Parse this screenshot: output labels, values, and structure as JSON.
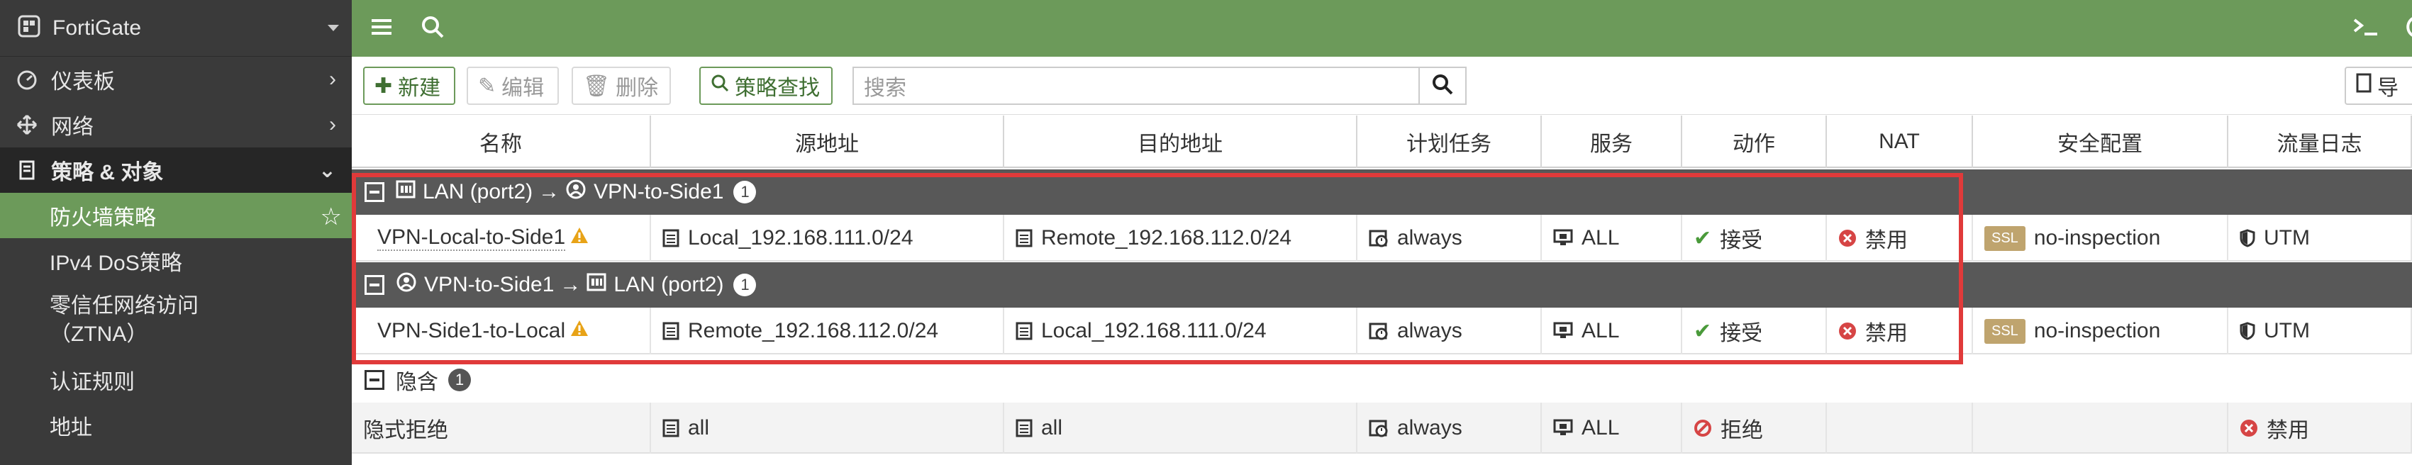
{
  "sidebar": {
    "brand": "FortiGate",
    "items": [
      {
        "label": "仪表板"
      },
      {
        "label": "网络"
      },
      {
        "label": "策略 & 对象"
      },
      {
        "label": "防火墙策略"
      },
      {
        "label": "IPv4 DoS策略"
      },
      {
        "label": "零信任网络访问\n（ZTNA）"
      },
      {
        "label": "认证规则"
      },
      {
        "label": "地址"
      }
    ]
  },
  "toolbar": {
    "new_label": "新建",
    "edit_label": "编辑",
    "delete_label": "删除",
    "policy_lookup_label": "策略查找",
    "search_placeholder": "搜索",
    "export_label": "导"
  },
  "table": {
    "columns": [
      "名称",
      "源地址",
      "目的地址",
      "计划任务",
      "服务",
      "动作",
      "NAT",
      "安全配置",
      "流量日志"
    ],
    "groups": [
      {
        "from": "LAN (port2)",
        "arrow": "→",
        "to": "VPN-to-Side1",
        "count": "1",
        "rows": [
          {
            "name": "VPN-Local-to-Side1",
            "src": "Local_192.168.111.0/24",
            "dst": "Remote_192.168.112.0/24",
            "schedule": "always",
            "service": "ALL",
            "action": "接受",
            "nat": "禁用",
            "ssl": "SSL",
            "security": "no-inspection",
            "log": "UTM"
          }
        ]
      },
      {
        "from": "VPN-to-Side1",
        "arrow": "→",
        "to": "LAN (port2)",
        "count": "1",
        "rows": [
          {
            "name": "VPN-Side1-to-Local",
            "src": "Remote_192.168.112.0/24",
            "dst": "Local_192.168.111.0/24",
            "schedule": "always",
            "service": "ALL",
            "action": "接受",
            "nat": "禁用",
            "ssl": "SSL",
            "security": "no-inspection",
            "log": "UTM"
          }
        ]
      }
    ],
    "implicit": {
      "label": "隐含",
      "count": "1",
      "row": {
        "name": "隐式拒绝",
        "src": "all",
        "dst": "all",
        "schedule": "always",
        "service": "ALL",
        "action": "拒绝",
        "log": "禁用"
      }
    }
  },
  "colors": {
    "brand_green": "#6c9a5a",
    "sidebar_bg": "#3a3a3a",
    "group_bg": "#585858",
    "highlight_red": "#e03a3a",
    "accept_green": "#4a9a3a",
    "deny_red": "#d64545"
  }
}
